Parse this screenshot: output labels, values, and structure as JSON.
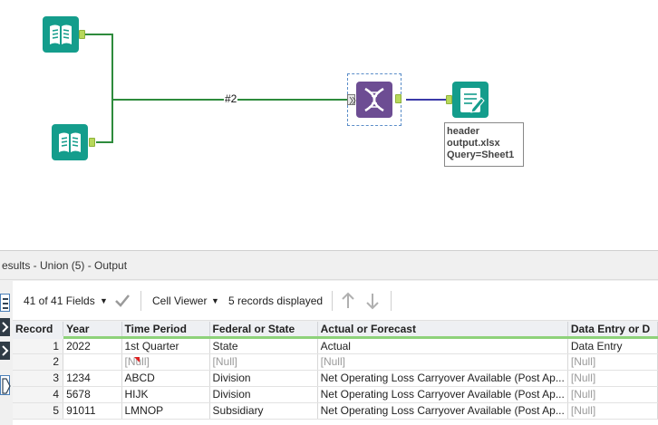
{
  "canvas": {
    "connection_label": "#2",
    "annotation": [
      "header",
      "output.xlsx",
      "Query=Sheet1"
    ],
    "colors": {
      "input_tool": "#149d8c",
      "union_tool": "#6d4d93",
      "wire": "#2e8b3c",
      "output_wire": "#3b3aa8"
    },
    "icons": {
      "input1": "book-icon",
      "input2": "book-icon",
      "union": "dna-icon",
      "output": "document-pen-icon"
    }
  },
  "results": {
    "title": "esults - Union (5) - Output",
    "toolbar": {
      "fields": "41 of 41 Fields",
      "cell_viewer": "Cell Viewer",
      "records": "5 records displayed"
    },
    "columns": [
      "Record",
      "Year",
      "Time Period",
      "Federal or State",
      "Actual or Forecast",
      "Data Entry or D"
    ],
    "rows": [
      [
        "1",
        "2022",
        "1st Quarter",
        "State",
        "Actual",
        "Data Entry"
      ],
      [
        "2",
        "",
        "[Null]",
        "[Null]",
        "[Null]",
        "[Null]"
      ],
      [
        "3",
        "1234",
        "ABCD",
        "Division",
        "Net Operating Loss Carryover Available (Post Ap...",
        "[Null]"
      ],
      [
        "4",
        "5678",
        "HIJK",
        "Division",
        "Net Operating Loss Carryover Available (Post Ap...",
        "[Null]"
      ],
      [
        "5",
        "91011",
        "LMNOP",
        "Subsidiary",
        "Net Operating Loss Carryover Available (Post Ap...",
        "[Null]"
      ]
    ]
  }
}
